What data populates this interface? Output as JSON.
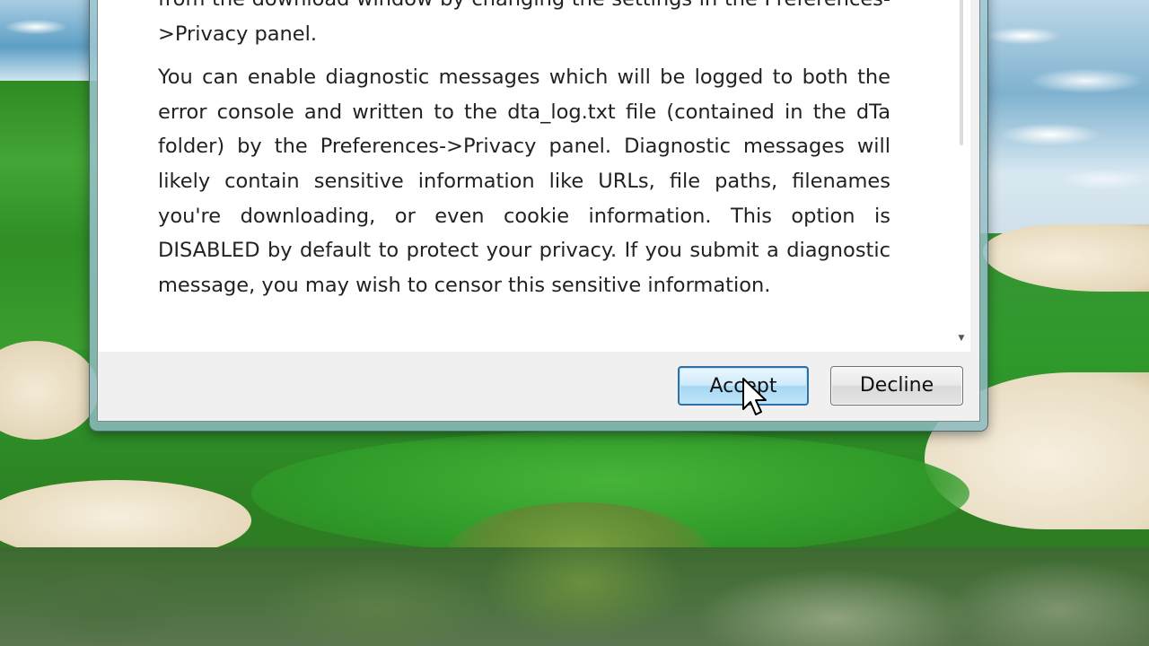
{
  "dialog": {
    "paragraphs": [
      "from the download window by changing the settings in the Preferences->Privacy panel.",
      "You can enable diagnostic messages which will be logged to both the error console and written to the dta_log.txt file (contained in the dTa folder) by the Preferences->Privacy panel. Diagnostic messages will likely contain sensitive information like URLs, file paths, filenames you're downloading, or even cookie information. This option is DISABLED by default to protect your privacy. If you submit a diagnostic message, you may wish to censor this sensitive information."
    ],
    "accept_label": "Accept",
    "decline_label": "Decline"
  },
  "icons": {
    "scroll_down": "scroll-down-arrow-icon",
    "cursor": "mouse-pointer-icon"
  },
  "colors": {
    "accept_border": "#2f6fa3",
    "accept_fill": "#bfe5f9",
    "window_frame": "#a0c8d2"
  }
}
